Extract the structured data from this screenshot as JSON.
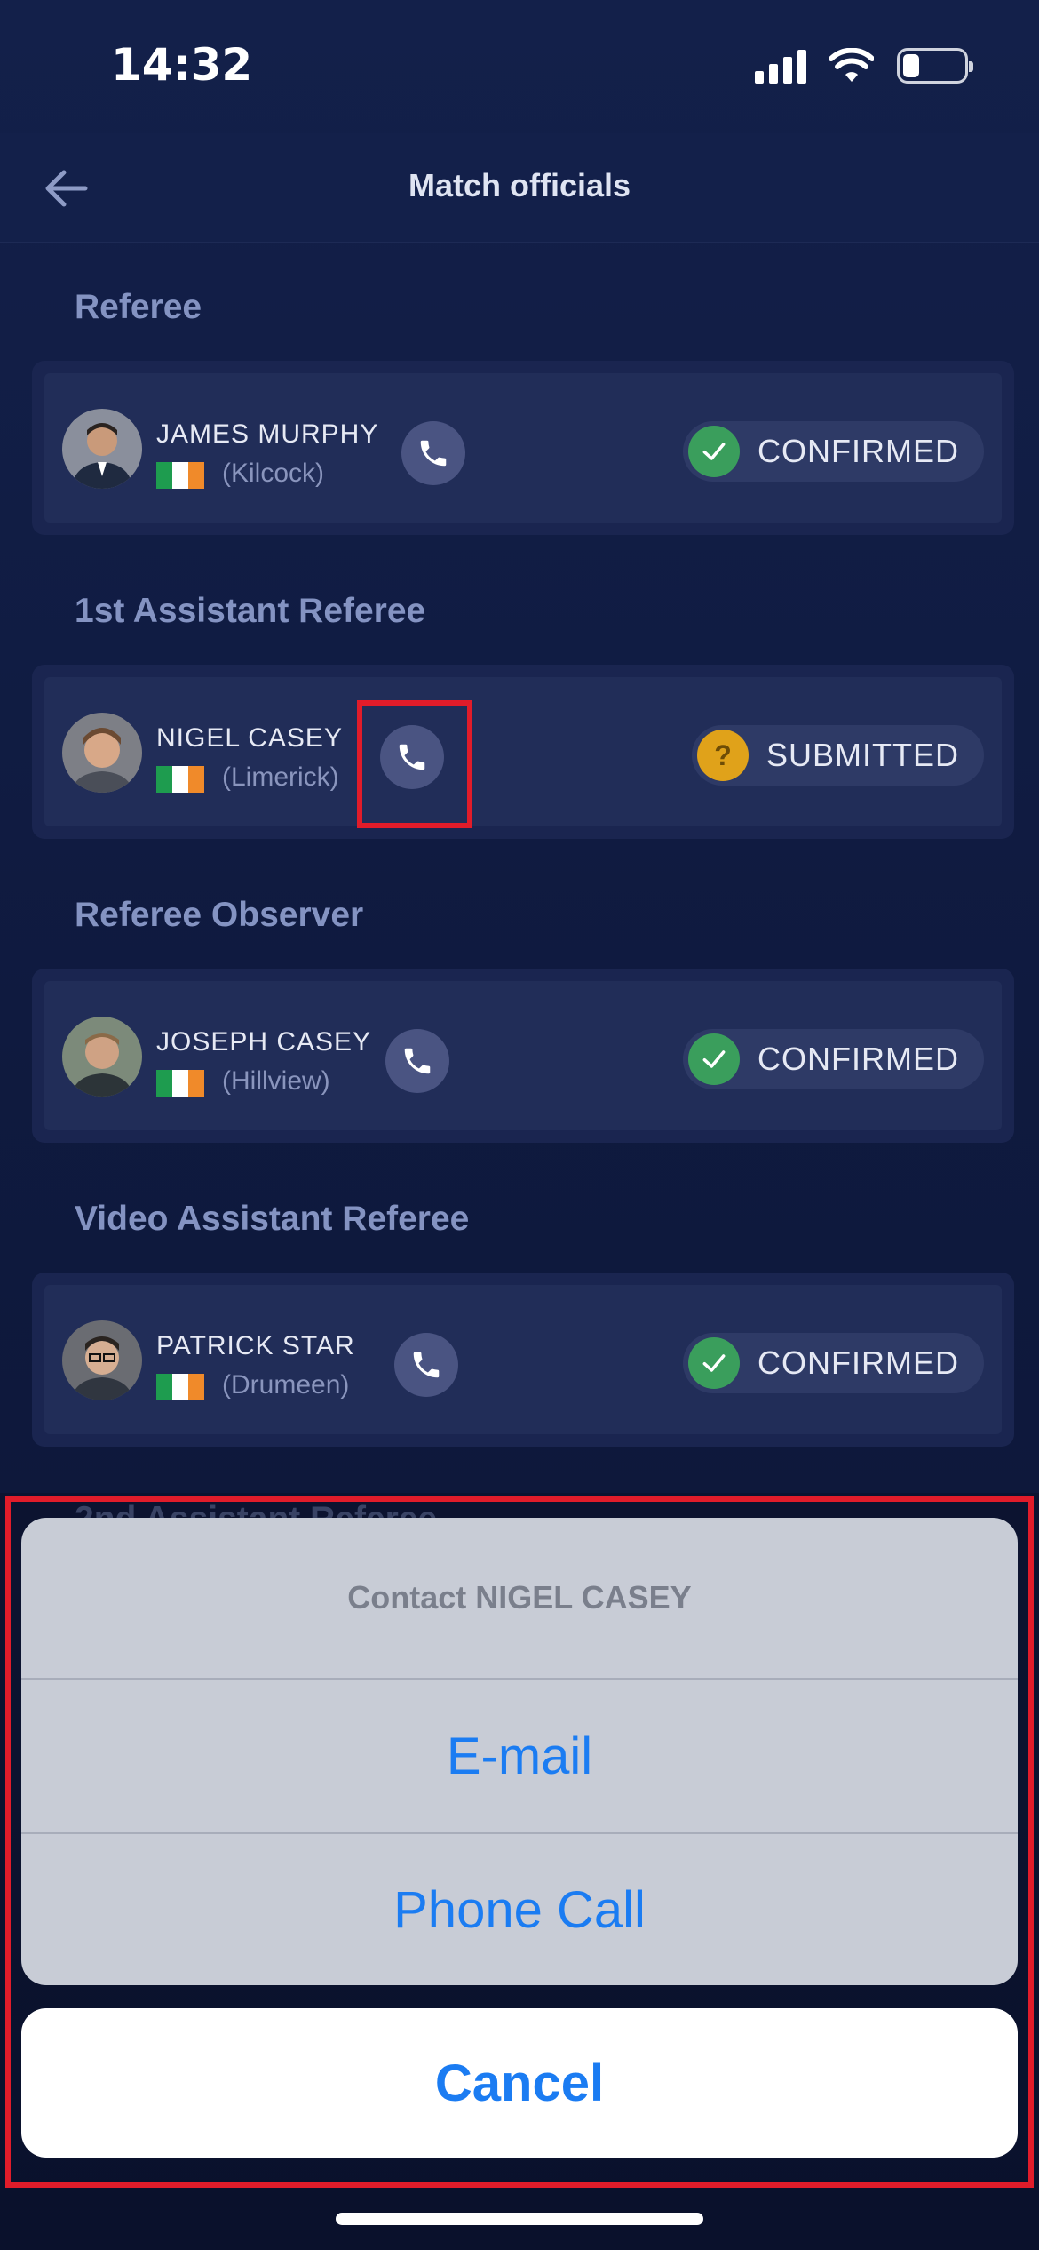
{
  "status_bar": {
    "time": "14:32"
  },
  "header": {
    "title": "Match officials"
  },
  "sections": [
    {
      "title": "Referee",
      "official": {
        "name": "JAMES MURPHY",
        "location": "(Kilcock)",
        "status": "CONFIRMED"
      }
    },
    {
      "title": "1st Assistant Referee",
      "official": {
        "name": "NIGEL CASEY",
        "location": "(Limerick)",
        "status": "SUBMITTED"
      }
    },
    {
      "title": "Referee Observer",
      "official": {
        "name": "JOSEPH CASEY",
        "location": "(Hillview)",
        "status": "CONFIRMED"
      }
    },
    {
      "title": "Video Assistant Referee",
      "official": {
        "name": "PATRICK STAR",
        "location": "(Drumeen)",
        "status": "CONFIRMED"
      }
    }
  ],
  "partially_hidden_section_title": "2nd Assistant Referee",
  "action_sheet": {
    "title": "Contact NIGEL CASEY",
    "options": [
      "E-mail",
      "Phone Call"
    ],
    "cancel": "Cancel"
  },
  "colors": {
    "background": "#13204a",
    "confirmed": "#3a9e5c",
    "submitted": "#e0a21a",
    "action_blue": "#1b7cf2",
    "highlight": "#e11c2a"
  },
  "icons": [
    "back-arrow-icon",
    "phone-icon",
    "check-icon",
    "question-icon",
    "ireland-flag-icon"
  ]
}
